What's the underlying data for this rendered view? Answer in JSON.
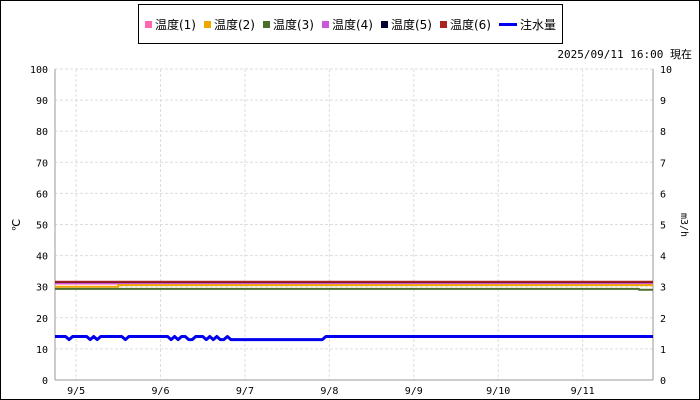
{
  "timestamp": "2025/09/11 16:00 現在",
  "chart_data": {
    "type": "line",
    "ylabel": "℃",
    "y2label": "m3/h",
    "ylim": [
      0,
      100
    ],
    "y2lim": [
      0,
      10
    ],
    "yticks": [
      "0",
      "10",
      "20",
      "30",
      "40",
      "50",
      "60",
      "70",
      "80",
      "90",
      "100"
    ],
    "y2ticks": [
      "0",
      "1",
      "2",
      "3",
      "4",
      "5",
      "6",
      "7",
      "8",
      "9",
      "10"
    ],
    "xlim": [
      "2025-09-04T18:00",
      "2025-09-11T20:00"
    ],
    "xticks": [
      {
        "x": "2025-09-05T00:00",
        "label": "9/5"
      },
      {
        "x": "2025-09-06T00:00",
        "label": "9/6"
      },
      {
        "x": "2025-09-07T00:00",
        "label": "9/7"
      },
      {
        "x": "2025-09-08T00:00",
        "label": "9/8"
      },
      {
        "x": "2025-09-09T00:00",
        "label": "9/9"
      },
      {
        "x": "2025-09-10T00:00",
        "label": "9/10"
      },
      {
        "x": "2025-09-11T00:00",
        "label": "9/11"
      }
    ],
    "grid": true,
    "legend_position": "top-center",
    "series": [
      {
        "name": "温度(1)",
        "color": "#ff66b2",
        "axis": "left",
        "marker": "square",
        "x": [
          "2025-09-04T18:00",
          "2025-09-11T20:00"
        ],
        "y": [
          31,
          31
        ]
      },
      {
        "name": "温度(2)",
        "color": "#f0a800",
        "axis": "left",
        "marker": "square",
        "x": [
          "2025-09-04T18:00",
          "2025-09-05T12:00",
          "2025-09-05T12:00",
          "2025-09-11T20:00"
        ],
        "y": [
          30,
          30,
          30.5,
          30.5
        ]
      },
      {
        "name": "温度(3)",
        "color": "#4b6e2b",
        "axis": "left",
        "marker": "square",
        "x": [
          "2025-09-04T18:00",
          "2025-09-11T16:00",
          "2025-09-11T16:00",
          "2025-09-11T20:00"
        ],
        "y": [
          29.3,
          29.3,
          29,
          29
        ]
      },
      {
        "name": "温度(4)",
        "color": "#cc55dd",
        "axis": "left",
        "marker": "square",
        "x": [
          "2025-09-04T18:00",
          "2025-09-11T20:00"
        ],
        "y": [
          31.2,
          31.2
        ]
      },
      {
        "name": "温度(5)",
        "color": "#000033",
        "axis": "left",
        "marker": "square",
        "x": [
          "2025-09-04T18:00",
          "2025-09-11T20:00"
        ],
        "y": [
          31.5,
          31.5
        ]
      },
      {
        "name": "温度(6)",
        "color": "#aa2222",
        "axis": "left",
        "marker": "square",
        "x": [
          "2025-09-04T18:00",
          "2025-09-11T20:00"
        ],
        "y": [
          31.6,
          31.6
        ]
      },
      {
        "name": "注水量",
        "color": "#0000ee",
        "axis": "right",
        "marker": "line",
        "x": [
          "2025-09-04T18:00",
          "2025-09-04T21:00",
          "2025-09-04T22:00",
          "2025-09-04T23:00",
          "2025-09-05T03:00",
          "2025-09-05T04:00",
          "2025-09-05T05:00",
          "2025-09-05T06:00",
          "2025-09-05T07:00",
          "2025-09-05T08:00",
          "2025-09-05T13:00",
          "2025-09-05T14:00",
          "2025-09-05T15:00",
          "2025-09-06T02:00",
          "2025-09-06T03:00",
          "2025-09-06T04:00",
          "2025-09-06T05:00",
          "2025-09-06T06:00",
          "2025-09-06T07:00",
          "2025-09-06T08:00",
          "2025-09-06T09:00",
          "2025-09-06T10:00",
          "2025-09-06T12:00",
          "2025-09-06T13:00",
          "2025-09-06T14:00",
          "2025-09-06T15:00",
          "2025-09-06T16:00",
          "2025-09-06T17:00",
          "2025-09-06T18:00",
          "2025-09-06T19:00",
          "2025-09-06T20:00",
          "2025-09-06T21:00",
          "2025-09-07T22:00",
          "2025-09-07T23:00",
          "2025-09-08T00:00",
          "2025-09-11T20:00"
        ],
        "y": [
          1.4,
          1.4,
          1.3,
          1.4,
          1.4,
          1.3,
          1.4,
          1.3,
          1.4,
          1.4,
          1.4,
          1.3,
          1.4,
          1.4,
          1.3,
          1.4,
          1.3,
          1.4,
          1.4,
          1.3,
          1.3,
          1.4,
          1.4,
          1.3,
          1.4,
          1.3,
          1.4,
          1.3,
          1.3,
          1.4,
          1.3,
          1.3,
          1.3,
          1.4,
          1.4,
          1.4
        ]
      }
    ]
  }
}
